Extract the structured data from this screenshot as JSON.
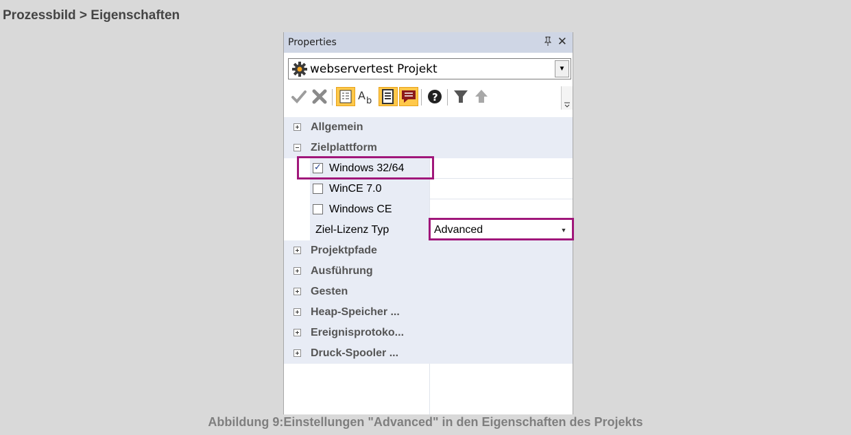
{
  "doc": {
    "heading": "Prozessbild > Eigenschaften",
    "caption": "Abbildung 9:Einstellungen \"Advanced\" in den Eigenschaften des Projekts"
  },
  "panel": {
    "title": "Properties",
    "pin_glyph": "ᵖ",
    "close_glyph": "✕",
    "object_selector": {
      "value": "webservertest Projekt",
      "icon": "gear-icon"
    },
    "toolbar": {
      "icons": [
        "apply-check-icon",
        "cancel-x-icon",
        "categorized-icon",
        "alphabetical-icon",
        "description-icon",
        "comment-icon",
        "help-icon",
        "filter-icon",
        "up-arrow-icon"
      ],
      "active_color": "#ffc84a"
    },
    "grid": {
      "categories": {
        "allgemein": "Allgemein",
        "zielplattform": "Zielplattform",
        "projektpfade": "Projektpfade",
        "ausfuehrung": "Ausführung",
        "gesten": "Gesten",
        "heap": "Heap-Speicher ...",
        "ereignis": "Ereignisprotoko...",
        "druck": "Druck-Spooler ..."
      },
      "platforms": [
        {
          "label": "Windows 32/64",
          "checked": true
        },
        {
          "label": "WinCE 7.0",
          "checked": false
        },
        {
          "label": "Windows CE",
          "checked": false
        }
      ],
      "license": {
        "label": "Ziel-Lizenz Typ",
        "value": "Advanced"
      }
    },
    "highlight_color": "#a0167a"
  }
}
